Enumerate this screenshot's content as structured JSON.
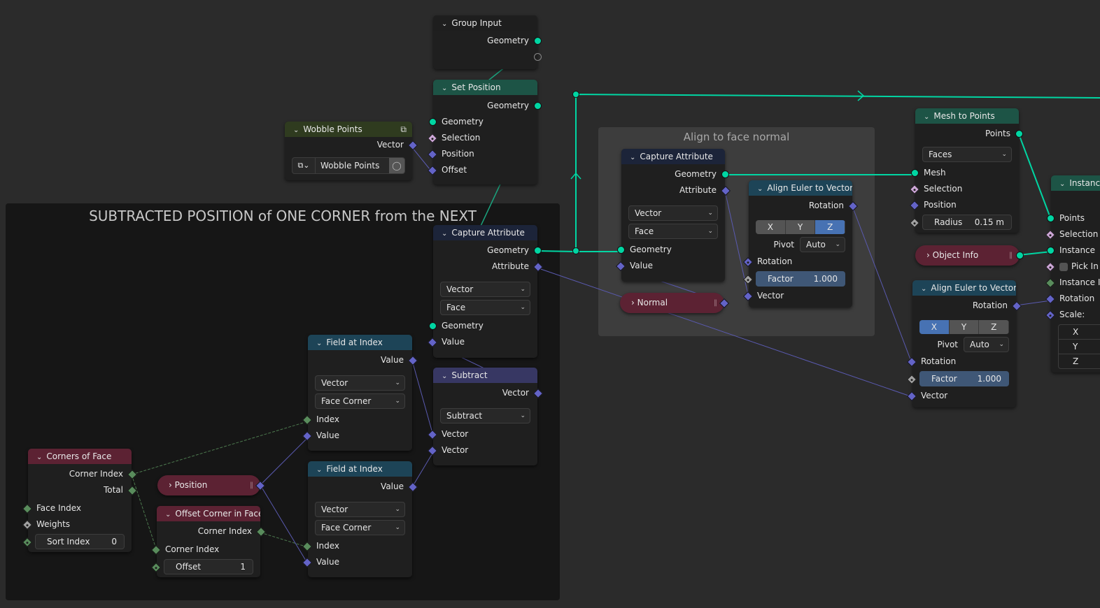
{
  "frames": {
    "subtracted": {
      "label": "SUBTRACTED POSITION of ONE CORNER from the NEXT"
    },
    "align": {
      "label": "Align to face normal"
    }
  },
  "colors": {
    "geometry_socket": "#00d6a3",
    "vector_socket": "#6363c7",
    "integer_socket": "#598c5c",
    "boolean_socket": "#cca6d6",
    "float_socket": "#a1a1a1",
    "selected_toggle": "#4772b3"
  },
  "nodes": {
    "group_input": {
      "title": "Group Input",
      "outputs": [
        "Geometry"
      ]
    },
    "set_position": {
      "title": "Set Position",
      "outputs": [
        "Geometry"
      ],
      "inputs": [
        "Geometry",
        "Selection",
        "Position",
        "Offset"
      ]
    },
    "wobble_points": {
      "title": "Wobble Points",
      "outputs": [
        "Vector"
      ],
      "group_name": "Wobble Points",
      "icon": "node-group-icon"
    },
    "capture_attr_1": {
      "title": "Capture Attribute",
      "outputs": [
        "Geometry",
        "Attribute"
      ],
      "data_type": "Vector",
      "domain": "Face",
      "inputs": [
        "Geometry",
        "Value"
      ]
    },
    "subtract": {
      "title": "Subtract",
      "outputs": [
        "Vector"
      ],
      "operation": "Subtract",
      "inputs": [
        "Vector",
        "Vector"
      ]
    },
    "field_at_index_1": {
      "title": "Field at Index",
      "outputs": [
        "Value"
      ],
      "data_type": "Vector",
      "domain": "Face Corner",
      "inputs": [
        "Index",
        "Value"
      ]
    },
    "field_at_index_2": {
      "title": "Field at Index",
      "outputs": [
        "Value"
      ],
      "data_type": "Vector",
      "domain": "Face Corner",
      "inputs": [
        "Index",
        "Value"
      ]
    },
    "corners_of_face": {
      "title": "Corners of Face",
      "outputs": [
        "Corner Index",
        "Total"
      ],
      "inputs": [
        "Face Index",
        "Weights"
      ],
      "sort_index": {
        "label": "Sort Index",
        "value": "0"
      }
    },
    "position": {
      "title": "Position"
    },
    "offset_corner": {
      "title": "Offset Corner in Face",
      "outputs": [
        "Corner Index"
      ],
      "inputs": [
        "Corner Index"
      ],
      "offset": {
        "label": "Offset",
        "value": "1"
      }
    },
    "capture_attr_2": {
      "title": "Capture Attribute",
      "outputs": [
        "Geometry",
        "Attribute"
      ],
      "data_type": "Vector",
      "domain": "Face",
      "inputs": [
        "Geometry",
        "Value"
      ]
    },
    "normal": {
      "title": "Normal"
    },
    "align_euler_1": {
      "title": "Align Euler to Vector",
      "outputs": [
        "Rotation"
      ],
      "axes": [
        "X",
        "Y",
        "Z"
      ],
      "active_axis": "Z",
      "pivot_label": "Pivot",
      "pivot": "Auto",
      "inputs": [
        "Rotation",
        "Vector"
      ],
      "factor": {
        "label": "Factor",
        "value": "1.000"
      }
    },
    "mesh_to_points": {
      "title": "Mesh to Points",
      "outputs": [
        "Points"
      ],
      "mode": "Faces",
      "inputs": [
        "Mesh",
        "Selection",
        "Position"
      ],
      "radius": {
        "label": "Radius",
        "value": "0.15 m"
      }
    },
    "object_info": {
      "title": "Object Info"
    },
    "align_euler_2": {
      "title": "Align Euler to Vector",
      "outputs": [
        "Rotation"
      ],
      "axes": [
        "X",
        "Y",
        "Z"
      ],
      "active_axis": "X",
      "pivot_label": "Pivot",
      "pivot": "Auto",
      "inputs": [
        "Rotation",
        "Vector"
      ],
      "factor": {
        "label": "Factor",
        "value": "1.000"
      }
    },
    "instance_on_points": {
      "title": "Instanc",
      "inputs": [
        "Points",
        "Selection",
        "Instance",
        "Pick In",
        "Instance I",
        "Rotation",
        "Scale:"
      ],
      "scale_axes": [
        "X",
        "Y",
        "Z"
      ]
    }
  }
}
